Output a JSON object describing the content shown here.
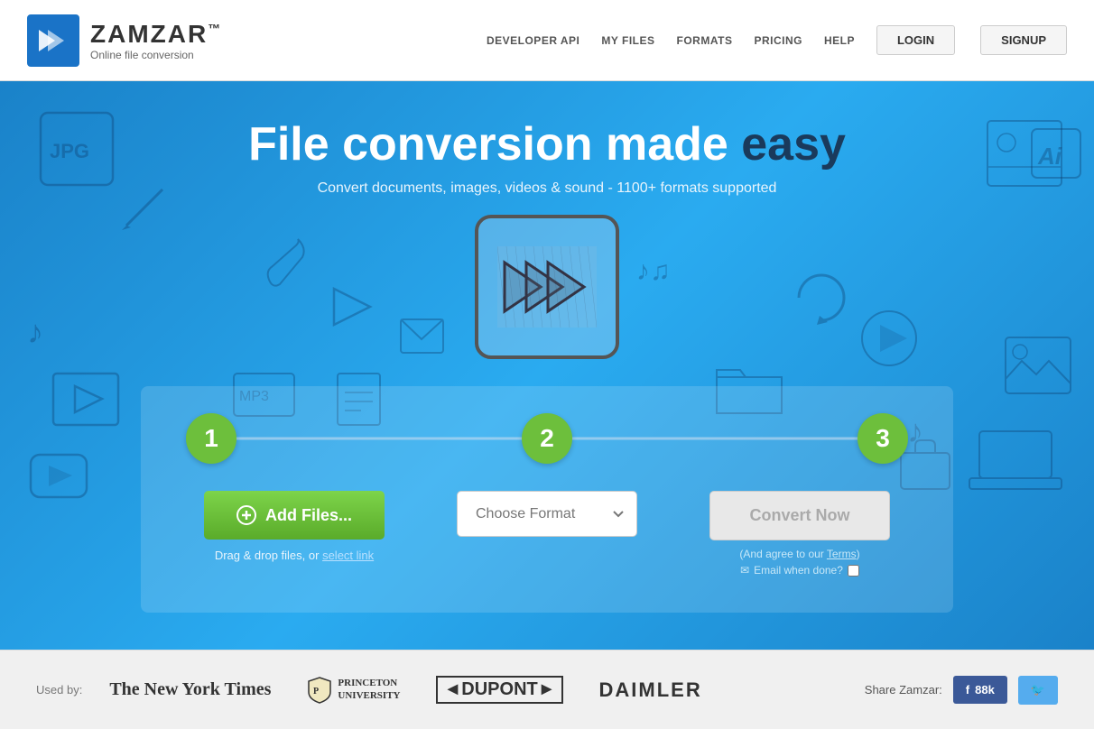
{
  "header": {
    "logo_name": "ZAMZAR",
    "logo_tm": "™",
    "logo_subtitle": "Online file conversion",
    "nav": {
      "developer_api": "DEVELOPER API",
      "my_files": "MY FILES",
      "formats": "FORMATS",
      "pricing": "PRICING",
      "help": "HELP",
      "login": "LOGIN",
      "signup": "SIGNUP"
    }
  },
  "hero": {
    "title_part1": "File ",
    "title_bold": "conversion",
    "title_part2": " made ",
    "title_dark": "easy",
    "subtitle": "Convert documents, images, videos & sound - 1100+ formats supported"
  },
  "steps": {
    "step1_number": "1",
    "step2_number": "2",
    "step3_number": "3",
    "add_files_label": "Add Files...",
    "drag_drop_text": "Drag & drop files, or",
    "select_link_text": "select link",
    "choose_format_placeholder": "Choose Format",
    "convert_now_label": "Convert Now",
    "terms_text": "(And agree to our",
    "terms_link": "Terms",
    "terms_close": ")",
    "email_label": "Email when done?",
    "choose_format_dropdown_symbol": "▾"
  },
  "footer": {
    "used_by_label": "Used by:",
    "partners": [
      {
        "name": "The New York Times",
        "style": "nyt"
      },
      {
        "name": "PRINCETON UNIVERSITY",
        "style": "princeton"
      },
      {
        "name": "◄DUPONT►",
        "style": "dupont"
      },
      {
        "name": "DAIMLER",
        "style": "daimler"
      }
    ],
    "share_label": "Share Zamzar:",
    "facebook_label": "f  88k",
    "twitter_icon": "🐦"
  },
  "colors": {
    "hero_bg": "#2196d3",
    "green": "#6dbf3c",
    "step_circle": "#6dbf3c",
    "white": "#ffffff",
    "dark_blue": "#1a3a5c"
  }
}
